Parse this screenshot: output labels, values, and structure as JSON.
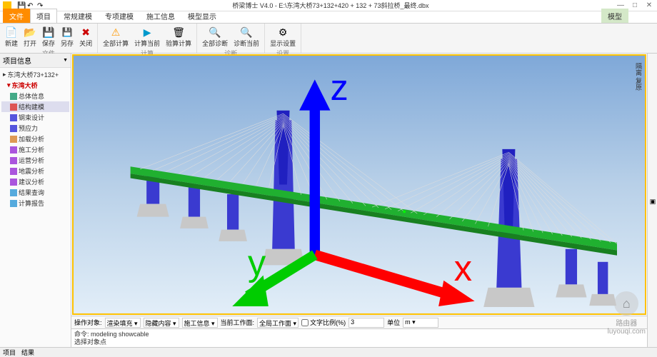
{
  "titlebar": {
    "title": "桥梁博士 V4.0 - E:\\东湾大桥73+132+420 + 132 + 73斜拉桥_最终.dbx"
  },
  "winbtns": {
    "min": "—",
    "max": "□",
    "close": "✕"
  },
  "ribbonTabs": {
    "file": "文件",
    "items": [
      "项目",
      "常规建模",
      "专项建模",
      "施工信息",
      "模型显示"
    ],
    "activeIndex": 0,
    "contextual": "模型"
  },
  "ribbon": {
    "groups": [
      {
        "name": "file-group",
        "label": "文件",
        "buttons": [
          {
            "name": "new-button",
            "icon": "i-new",
            "label": "新建"
          },
          {
            "name": "open-button",
            "icon": "i-open",
            "label": "打开"
          },
          {
            "name": "save-button",
            "icon": "i-save",
            "label": "保存"
          },
          {
            "name": "saveas-button",
            "icon": "i-saveas",
            "label": "另存"
          },
          {
            "name": "close-button",
            "icon": "i-close",
            "label": "关闭"
          }
        ]
      },
      {
        "name": "calc-group",
        "label": "计算",
        "buttons": [
          {
            "name": "warn-button",
            "icon": "i-warn",
            "label": "全部计算"
          },
          {
            "name": "calc-button",
            "icon": "i-play",
            "label": "计算当前"
          },
          {
            "name": "clear-button",
            "icon": "i-clear",
            "label": "验算计算"
          }
        ]
      },
      {
        "name": "diag-group",
        "label": "诊断",
        "buttons": [
          {
            "name": "diag-all-button",
            "icon": "i-diag",
            "label": "全部诊断"
          },
          {
            "name": "diag-cur-button",
            "icon": "i-diag",
            "label": "诊断当前"
          }
        ]
      },
      {
        "name": "settings-group",
        "label": "设置",
        "buttons": [
          {
            "name": "display-set-button",
            "icon": "i-set",
            "label": "显示设置"
          }
        ]
      }
    ]
  },
  "sidebar": {
    "title": "项目信息",
    "root": "东湾大桥73+132+",
    "rootSub": "东湾大桥",
    "items": [
      {
        "name": "tree-general-info",
        "icon": "ti-info",
        "label": "总体信息"
      },
      {
        "name": "tree-structure",
        "icon": "ti-struct",
        "label": "结构建模",
        "active": true
      },
      {
        "name": "tree-steel",
        "icon": "ti-steel",
        "label": "钢束设计"
      },
      {
        "name": "tree-prestress",
        "icon": "ti-steel",
        "label": "预应力"
      },
      {
        "name": "tree-load",
        "icon": "ti-load",
        "label": "加载分析"
      },
      {
        "name": "tree-construct",
        "icon": "ti-analysis",
        "label": "施工分析"
      },
      {
        "name": "tree-operate",
        "icon": "ti-analysis",
        "label": "运营分析"
      },
      {
        "name": "tree-seismic",
        "icon": "ti-analysis",
        "label": "地震分析"
      },
      {
        "name": "tree-check",
        "icon": "ti-analysis",
        "label": "建议分析"
      },
      {
        "name": "tree-results",
        "icon": "ti-report",
        "label": "结果查询"
      },
      {
        "name": "tree-report",
        "icon": "ti-report",
        "label": "计算报告"
      }
    ]
  },
  "viewport": {
    "vertLabel": "隔离  复原"
  },
  "rightStrip": {
    "items": [
      "▣",
      "▦",
      "◧",
      "↻"
    ]
  },
  "bottomToolbar": {
    "opTargetLabel": "操作对象:",
    "opTarget": "渲染填充",
    "hideLabel": "隐藏内容",
    "constructTab": "施工信息",
    "currentWorkLabel": "当前工作面:",
    "currentWork": "全局工作面",
    "textScaleLabel": "文字比例(%)",
    "textScale": "3",
    "unitLabel": "单位",
    "unit": "m"
  },
  "cmd": {
    "line1": "命令: modeling showcable",
    "line2": "选择对象点"
  },
  "statusbar": {
    "tabs": [
      "项目",
      "结果"
    ]
  },
  "watermark": {
    "name": "路由器",
    "url": "luyouqi.com"
  },
  "axis": {
    "x": "x",
    "y": "y",
    "z": "z"
  }
}
